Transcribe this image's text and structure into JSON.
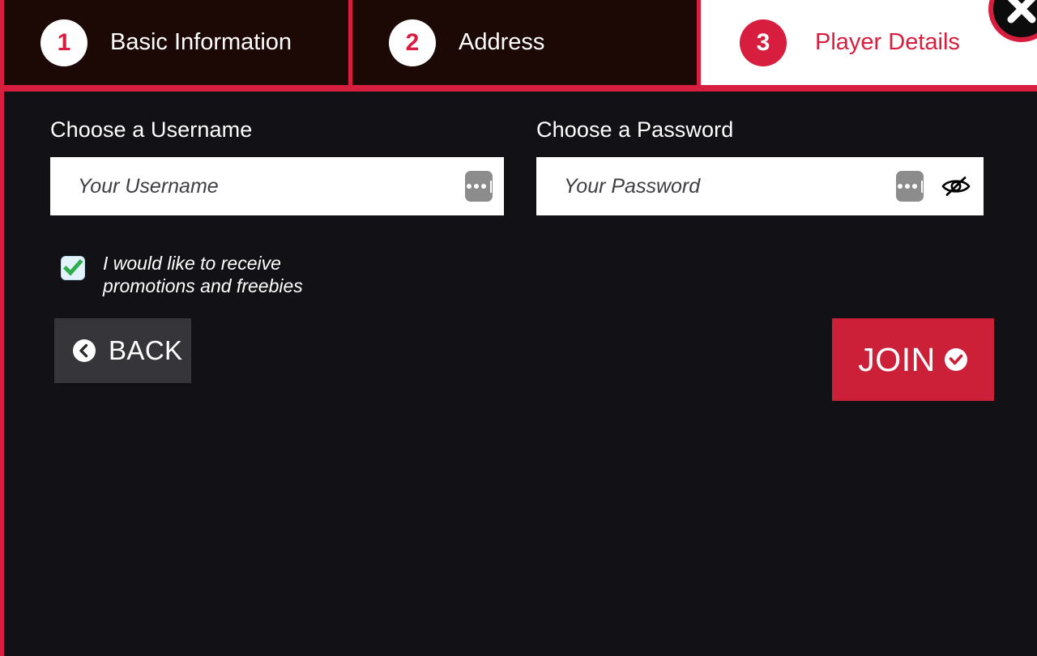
{
  "window": {
    "background_color": "#111116",
    "accent_color": "#d81e3e"
  },
  "close_button": {
    "name": "close",
    "icon": "close-x-icon"
  },
  "stepper": {
    "steps": [
      {
        "number": "1",
        "label": "Basic Information",
        "active": false
      },
      {
        "number": "2",
        "label": "Address",
        "active": false
      },
      {
        "number": "3",
        "label": "Player Details",
        "active": true
      }
    ]
  },
  "form": {
    "username": {
      "label": "Choose a Username",
      "placeholder": "Your Username",
      "value": "",
      "suggest_icon": "ellipsis-icon"
    },
    "password": {
      "label": "Choose a Password",
      "placeholder": "Your Password",
      "value": "",
      "suggest_icon": "ellipsis-icon",
      "reveal_icon": "eye-slash-icon"
    },
    "promotions_checkbox": {
      "label": "I would like to receive promotions and freebies",
      "checked": true,
      "check_color": "#2eae4e"
    }
  },
  "actions": {
    "back": {
      "label": "BACK",
      "icon": "chevron-left-circle-icon"
    },
    "join": {
      "label": "JOIN",
      "icon": "check-circle-icon",
      "color": "#cc2039"
    }
  }
}
